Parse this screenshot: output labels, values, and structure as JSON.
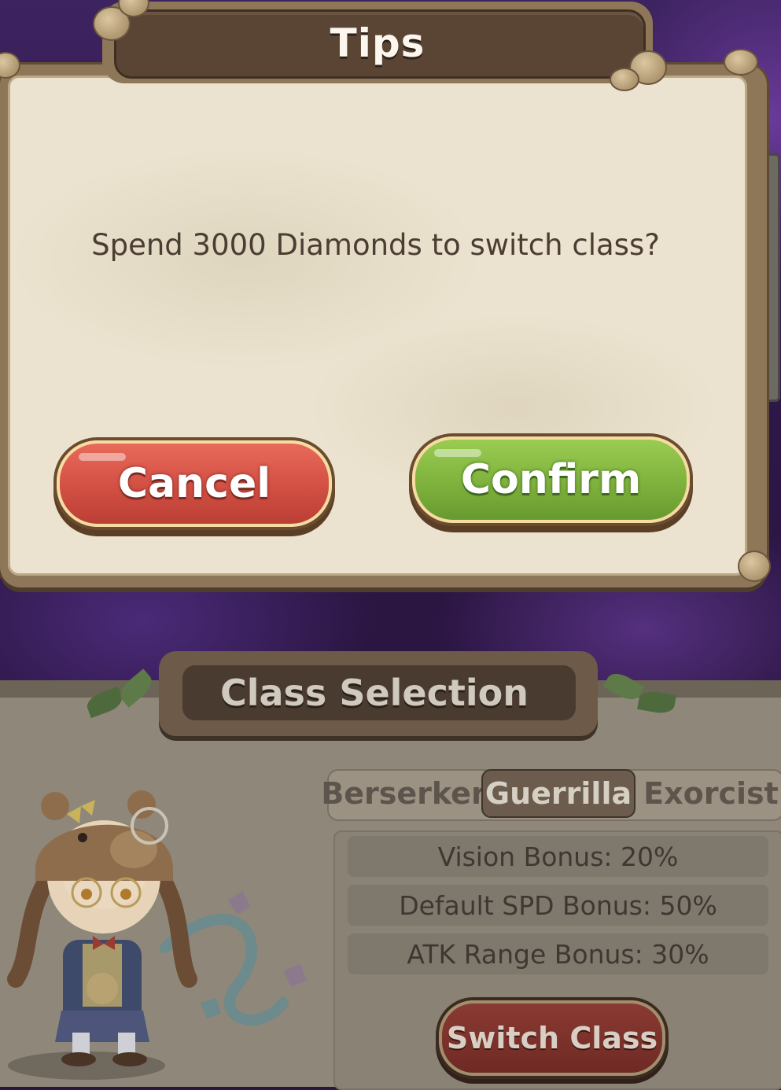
{
  "dialog": {
    "title": "Tips",
    "message": "Spend 3000 Diamonds to switch class?",
    "cancel_label": "Cancel",
    "confirm_label": "Confirm"
  },
  "class_panel": {
    "title": "Class Selection",
    "tabs": [
      {
        "label": "Berserker",
        "active": false
      },
      {
        "label": "Guerrilla",
        "active": true
      },
      {
        "label": "Exorcist",
        "active": false
      }
    ],
    "stats": [
      "Vision Bonus: 20%",
      "Default SPD Bonus: 50%",
      "ATK Range Bonus: 30%"
    ],
    "switch_label": "Switch Class"
  },
  "colors": {
    "cancel": "#d24f43",
    "confirm": "#7fb23d",
    "parchment": "#ebe3cf",
    "wood": "#5a4535"
  }
}
